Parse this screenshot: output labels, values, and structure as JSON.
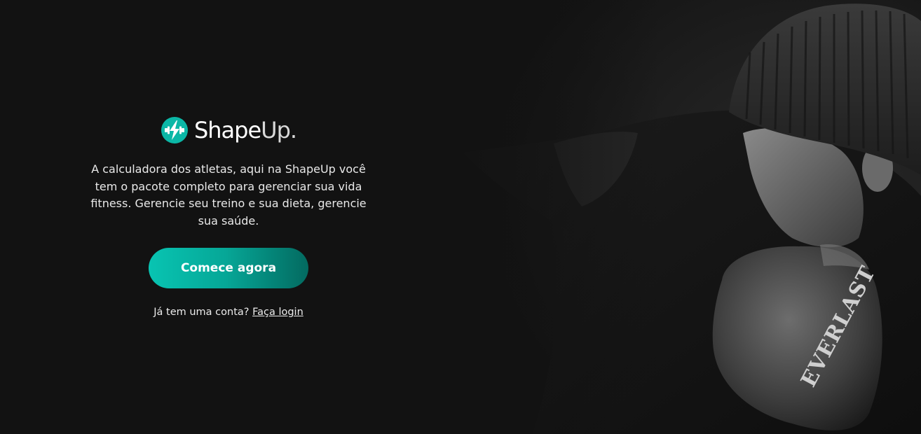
{
  "brand": {
    "name_main": "Shape",
    "name_tail": "Up.",
    "logo_icon": "lightning-dumbbell-icon",
    "accent_color": "#09bfae"
  },
  "intro": {
    "tagline": "A calculadora dos atletas, aqui na ShapeUp você tem o pacote completo para gerenciar sua vida fitness. Gerencie seu treino e sua dieta, gerencie sua saúde."
  },
  "cta": {
    "label": "Comece agora"
  },
  "login": {
    "prompt": "Já tem uma conta?",
    "link_label": "Faça login"
  },
  "hero": {
    "glove_text": "EVERLAST"
  }
}
